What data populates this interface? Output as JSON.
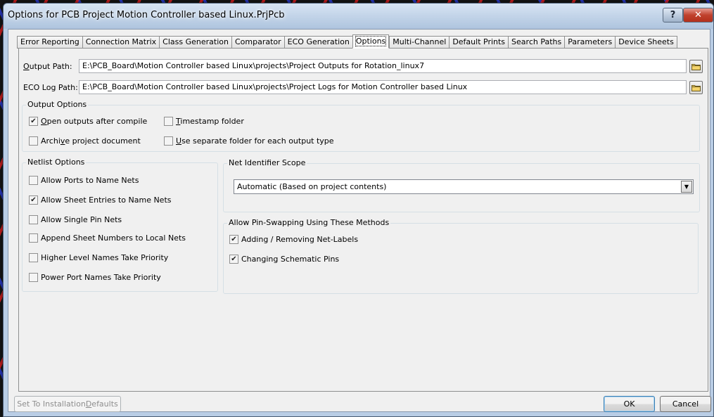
{
  "window": {
    "title": "Options for PCB Project Motion Controller based Linux.PrjPcb",
    "help_label": "?",
    "close_label": "✕"
  },
  "tabs": [
    {
      "label": "Error Reporting"
    },
    {
      "label": "Connection Matrix"
    },
    {
      "label": "Class Generation"
    },
    {
      "label": "Comparator"
    },
    {
      "label": "ECO Generation"
    },
    {
      "label": "Options"
    },
    {
      "label": "Multi-Channel"
    },
    {
      "label": "Default Prints"
    },
    {
      "label": "Search Paths"
    },
    {
      "label": "Parameters"
    },
    {
      "label": "Device Sheets"
    }
  ],
  "active_tab": "Options",
  "paths": {
    "output_label_a": "O",
    "output_label_b": "utput Path:",
    "output_value": "E:\\PCB_Board\\Motion Controller based Linux\\projects\\Project Outputs for Rotation_linux7",
    "eco_label": "ECO Log Path:",
    "eco_value": "E:\\PCB_Board\\Motion Controller based Linux\\projects\\Project Logs for Motion Controller based Linux"
  },
  "output_options": {
    "title": "Output Options",
    "items": [
      {
        "pre": "",
        "key": "O",
        "post": "pen outputs after compile",
        "checked": true
      },
      {
        "pre": "",
        "key": "T",
        "post": "imestamp folder",
        "checked": false
      },
      {
        "pre": "Archi",
        "key": "v",
        "post": "e project document",
        "checked": false
      },
      {
        "pre": "",
        "key": "U",
        "post": "se separate folder for each output type",
        "checked": false
      }
    ]
  },
  "netlist_options": {
    "title": "Netlist Options",
    "items": [
      {
        "label": "Allow Ports to Name Nets",
        "checked": false
      },
      {
        "label": "Allow Sheet Entries to Name Nets",
        "checked": true
      },
      {
        "label": "Allow Single Pin Nets",
        "checked": false
      },
      {
        "label": "Append Sheet Numbers to Local Nets",
        "checked": false
      },
      {
        "label": "Higher Level Names Take Priority",
        "checked": false
      },
      {
        "label": "Power Port Names Take Priority",
        "checked": false
      }
    ]
  },
  "net_identifier_scope": {
    "title": "Net Identifier Scope",
    "selected": "Automatic (Based on project contents)"
  },
  "pin_swapping": {
    "title": "Allow Pin-Swapping Using These Methods",
    "items": [
      {
        "label": "Adding / Removing Net-Labels",
        "checked": true
      },
      {
        "label": "Changing Schematic Pins",
        "checked": true
      }
    ]
  },
  "buttons": {
    "defaults_pre": "Set To Installation ",
    "defaults_key": "D",
    "defaults_post": "efaults",
    "ok": "OK",
    "cancel": "Cancel"
  },
  "icons": {
    "browse": "folder-icon",
    "dropdown": "chevron-down-icon",
    "check": "checkmark-icon"
  }
}
